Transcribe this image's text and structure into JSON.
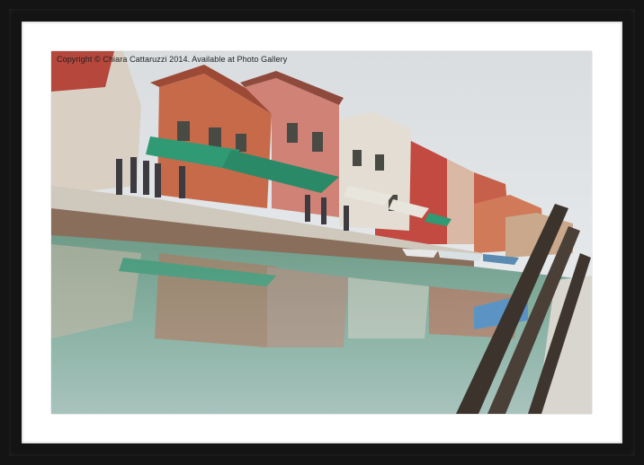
{
  "watermark": "Copyright © Chiara Cattaruzzi 2014. Available at Photo Gallery",
  "colors": {
    "frame": "#141414",
    "mount": "#ffffff",
    "sky": "#dfe3e6",
    "canal": "#7aa595",
    "awning": "#2f9a74"
  }
}
